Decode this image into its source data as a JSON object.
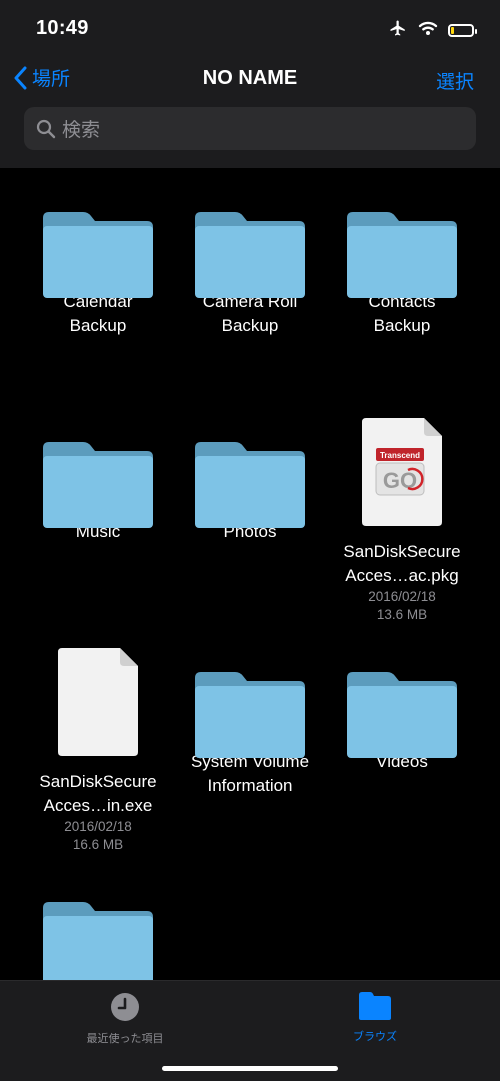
{
  "status": {
    "time": "10:49"
  },
  "nav": {
    "back_label": "場所",
    "title": "NO NAME",
    "select_label": "選択"
  },
  "search": {
    "placeholder": "検索"
  },
  "items": [
    {
      "kind": "folder",
      "name_line1": "Calendar",
      "name_line2": "Backup"
    },
    {
      "kind": "folder",
      "name_line1": "Camera Roll",
      "name_line2": "Backup"
    },
    {
      "kind": "folder",
      "name_line1": "Contacts",
      "name_line2": "Backup"
    },
    {
      "kind": "folder",
      "name_line1": "Music",
      "name_line2": ""
    },
    {
      "kind": "folder",
      "name_line1": "Photos",
      "name_line2": ""
    },
    {
      "kind": "pkg",
      "name_line1": "SanDiskSecure",
      "name_line2": "Acces…ac.pkg",
      "date": "2016/02/18",
      "size": "13.6 MB",
      "thumb_brand": "Transcend",
      "thumb_mark": "GO"
    },
    {
      "kind": "exe",
      "name_line1": "SanDiskSecure",
      "name_line2": "Acces…in.exe",
      "date": "2016/02/18",
      "size": "16.6 MB"
    },
    {
      "kind": "folder",
      "name_line1": "System Volume",
      "name_line2": "Information"
    },
    {
      "kind": "folder",
      "name_line1": "Videos",
      "name_line2": ""
    },
    {
      "kind": "folder",
      "name_line1": "",
      "name_line2": ""
    }
  ],
  "tabbar": {
    "recents_label": "最近使った項目",
    "browse_label": "ブラウズ"
  },
  "colors": {
    "accent": "#0a84ff",
    "folder_front": "#7ec3e6",
    "folder_back": "#5c9cbd",
    "bar_bg": "#1c1c1e",
    "secondary_text": "#8e8e93"
  },
  "icons": {
    "airplane": "airplane-icon",
    "wifi": "wifi-icon",
    "battery": "battery-icon",
    "back": "chevron-left-icon",
    "search": "search-icon",
    "recents": "clock-icon",
    "browse": "folder-icon"
  }
}
